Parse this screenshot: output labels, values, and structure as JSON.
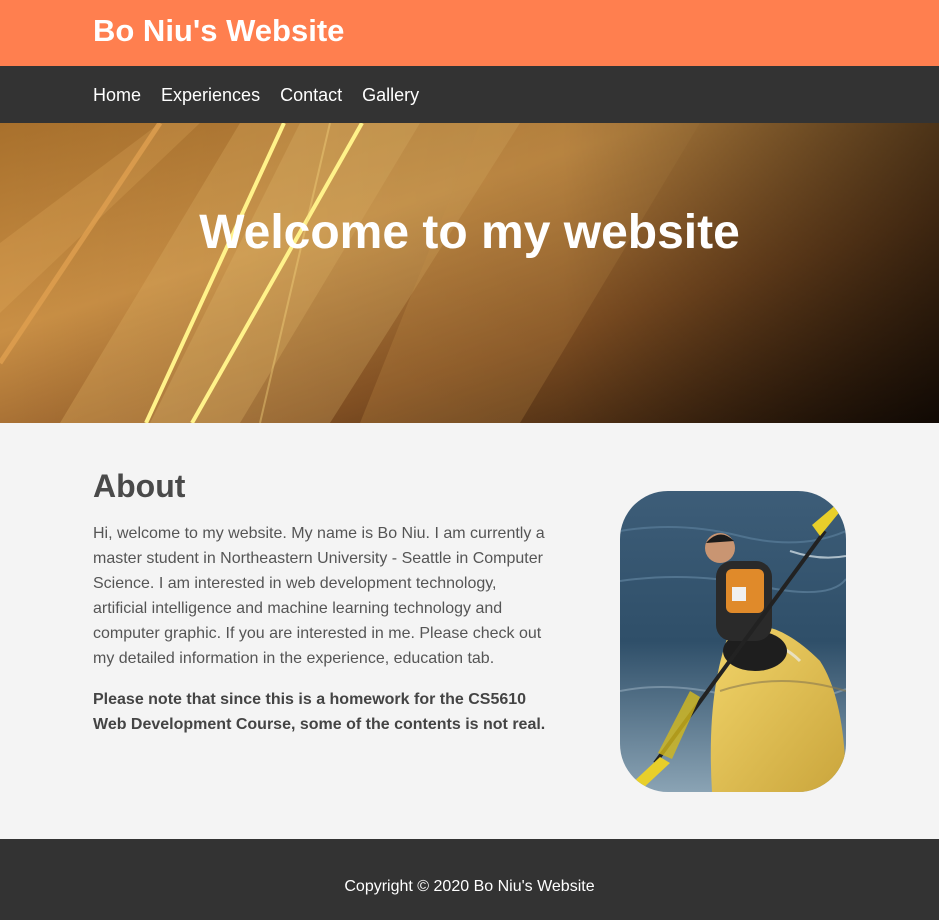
{
  "header": {
    "site_title": "Bo Niu's Website"
  },
  "nav": {
    "items": [
      {
        "label": "Home"
      },
      {
        "label": "Experiences"
      },
      {
        "label": "Contact"
      },
      {
        "label": "Gallery"
      }
    ]
  },
  "hero": {
    "title": "Welcome to my website"
  },
  "about": {
    "heading": "About",
    "paragraph": "Hi, welcome to my website. My name is Bo Niu. I am currently a master student in Northeastern University - Seattle in Computer Science. I am interested in web development technology, artificial intelligence and machine learning technology and computer graphic. If you are interested in me. Please check out my detailed information in the experience, education tab.",
    "note": "Please note that since this is a homework for the CS5610 Web Development Course, some of the contents is not real."
  },
  "footer": {
    "copyright": "Copyright © 2020 Bo Niu's Website"
  },
  "colors": {
    "header_bg": "#ff7f4f",
    "nav_bg": "#333333",
    "footer_bg": "#333333",
    "page_bg": "#f4f4f4"
  }
}
